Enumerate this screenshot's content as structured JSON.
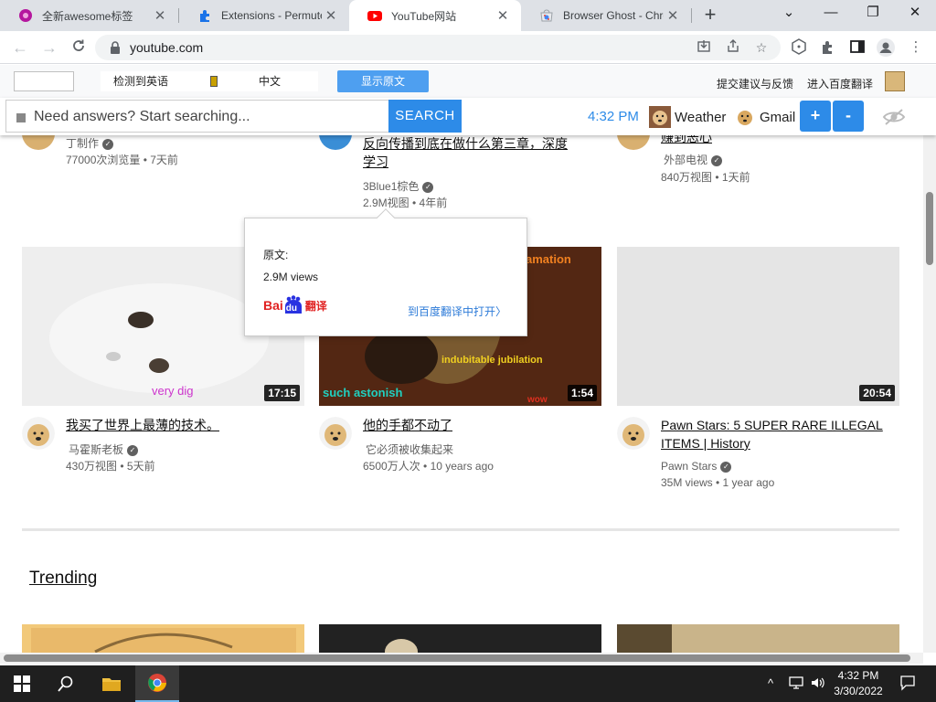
{
  "tabs": [
    {
      "title": "全新awesome标签",
      "icon": "awesome-tab-icon"
    },
    {
      "title": "Extensions - Permute",
      "icon": "puzzle-icon"
    },
    {
      "title": "YouTube网站",
      "icon": "youtube-icon"
    },
    {
      "title": "Browser Ghost - Chron",
      "icon": "chrome-webstore-icon"
    }
  ],
  "window_controls": {
    "menu": "⌄",
    "minimize": "—",
    "restore": "❐",
    "close": "✕"
  },
  "toolbar": {
    "url": "youtube.com"
  },
  "translate_bar": {
    "detected": "检测到英语",
    "target": "中文",
    "show_original": "显示原文",
    "feedback": "提交建议与反馈",
    "open_baidu": "进入百度翻译"
  },
  "search_ext": {
    "placeholder": "Need answers? Start searching...",
    "search_label": "SEARCH",
    "time": "4:32 PM",
    "weather": "Weather",
    "gmail": "Gmail",
    "plus": "+",
    "minus": "-"
  },
  "top_row": [
    {
      "channel": "丁制作",
      "meta": "77000次浏览量 • 7天前"
    },
    {
      "title_line1": "反向传播到底在做什么第三章，深度",
      "title_line2": "学习",
      "channel": "3Blue1棕色",
      "meta": "2.9M视图 • 4年前"
    },
    {
      "title_partial": "赚到恶心",
      "channel": "外部电视",
      "meta": "840万视图 • 1天前"
    }
  ],
  "videos": [
    {
      "title": "我买了世界上最薄的技术。",
      "channel": "马霍斯老板",
      "meta": "430万视图 • 5天前",
      "duration": "17:15",
      "overlay_text": "very dig"
    },
    {
      "title": "他的手都不动了",
      "channel": "它必须被收集起来",
      "meta": "6500万人次 • 10 years ago",
      "duration": "1:54",
      "overlay_top": "amation",
      "overlay_mid": "indubitable jubilation",
      "overlay_bottom": "such astonish",
      "overlay_wow": "wow"
    },
    {
      "title_line1": "Pawn Stars: 5 SUPER RARE ILLEGAL",
      "title_line2": "ITEMS | History",
      "channel": "Pawn Stars",
      "meta": "35M views • 1 year ago",
      "duration": "20:54"
    }
  ],
  "section_title": "Trending",
  "popup": {
    "label": "原文:",
    "original": "2.9M views",
    "logo_brand": "Bai",
    "logo_du": "du",
    "logo_suffix": "翻译",
    "open_link": "到百度翻译中打开〉"
  },
  "taskbar": {
    "time": "4:32 PM",
    "date": "3/30/2022"
  },
  "colors": {
    "accent_blue": "#2d8be8",
    "youtube_red": "#ff0000",
    "taskbar": "#1f1f1f"
  }
}
